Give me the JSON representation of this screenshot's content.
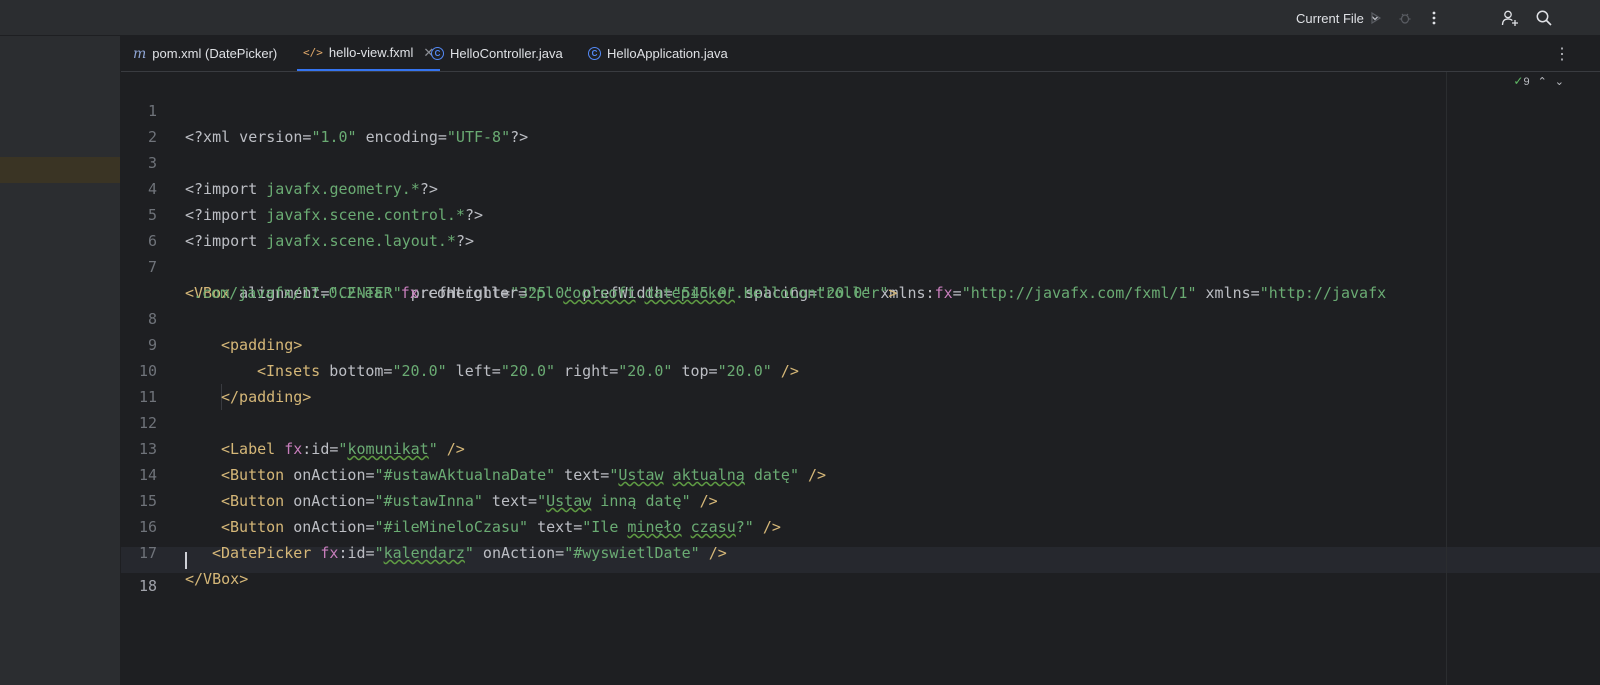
{
  "titlebar": {
    "run_config_label": "Current File",
    "icons": [
      "chevron-down-icon",
      "run-icon",
      "debug-icon",
      "more-icon",
      "add-user-icon",
      "search-icon"
    ]
  },
  "tabs": [
    {
      "label": "pom.xml (DatePicker)",
      "icon": "maven-icon",
      "active": false
    },
    {
      "label": "hello-view.fxml",
      "icon": "xml-file-icon",
      "active": true
    },
    {
      "label": "HelloController.java",
      "icon": "java-class-icon",
      "active": false
    },
    {
      "label": "HelloApplication.java",
      "icon": "java-class-icon",
      "active": false
    }
  ],
  "editor": {
    "inspection_count": "9",
    "current_line": "18",
    "line_numbers": [
      "1",
      "2",
      "3",
      "4",
      "5",
      "6",
      "7",
      "8",
      "9",
      "10",
      "11",
      "12",
      "13",
      "14",
      "15",
      "16",
      "17",
      "18"
    ],
    "lines": {
      "l1": [
        "<?xml version=",
        "\"1.0\"",
        " encoding=",
        "\"UTF-8\"",
        "?>"
      ],
      "l3": [
        "<?import ",
        "javafx.geometry.*",
        "?>"
      ],
      "l4": [
        "<?import ",
        "javafx.scene.control.*",
        "?>"
      ],
      "l5": [
        "<?import ",
        "javafx.scene.layout.*",
        "?>"
      ],
      "l7": [
        "<VBox",
        " alignment=",
        "\"CENTER\"",
        " prefHeight=",
        "\"325.0\"",
        " prefWidth=",
        "\"545.0\"",
        " spacing=",
        "\"20.0\"",
        " xmlns:",
        "fx",
        "=",
        "\"http://javafx.com/fxml/1\"",
        " xmlns=",
        "\"http://javafx"
      ],
      "l7b": [
        ".com/javafx/17.0.2-ea\"",
        " ",
        "fx",
        ":controller=",
        "\"pl.",
        "coolsoft",
        ".",
        "datepicker",
        ".HelloController\"",
        ">"
      ],
      "l8": [
        "<padding",
        ">"
      ],
      "l9": [
        "<Insets",
        " bottom=",
        "\"20.0\"",
        " left=",
        "\"20.0\"",
        " right=",
        "\"20.0\"",
        " top=",
        "\"20.0\"",
        " />"
      ],
      "l10": [
        "</padding",
        ">"
      ],
      "l12": [
        "<Label",
        " ",
        "fx",
        ":id=",
        "\"",
        "komunikat",
        "\"",
        " />"
      ],
      "l13": [
        "<Button",
        " onAction=",
        "\"#ustawAktualnaDate\"",
        " text=",
        "\"",
        "Ustaw",
        " ",
        "aktualną",
        " datę\"",
        " />"
      ],
      "l14": [
        "<Button",
        " onAction=",
        "\"#ustawInna\"",
        " text=",
        "\"",
        "Ustaw",
        " inną datę\"",
        " />"
      ],
      "l15": [
        "<Button",
        " onAction=",
        "\"#ileMineloCzasu\"",
        " text=",
        "\"Ile ",
        "minęło",
        " ",
        "czasu",
        "?\"",
        " />"
      ],
      "l16": [
        "<DatePicker",
        " ",
        "fx",
        ":id=",
        "\"",
        "kalendarz",
        "\"",
        " onAction=",
        "\"#wyswietlDate\"",
        " />"
      ],
      "l17": [
        "</VBox",
        ">"
      ]
    }
  },
  "colors": {
    "background": "#1e1f22",
    "panel": "#2b2d30",
    "tag": "#d5b778",
    "string": "#6aab73",
    "namespace": "#c77dbb",
    "accent": "#3574f0"
  }
}
